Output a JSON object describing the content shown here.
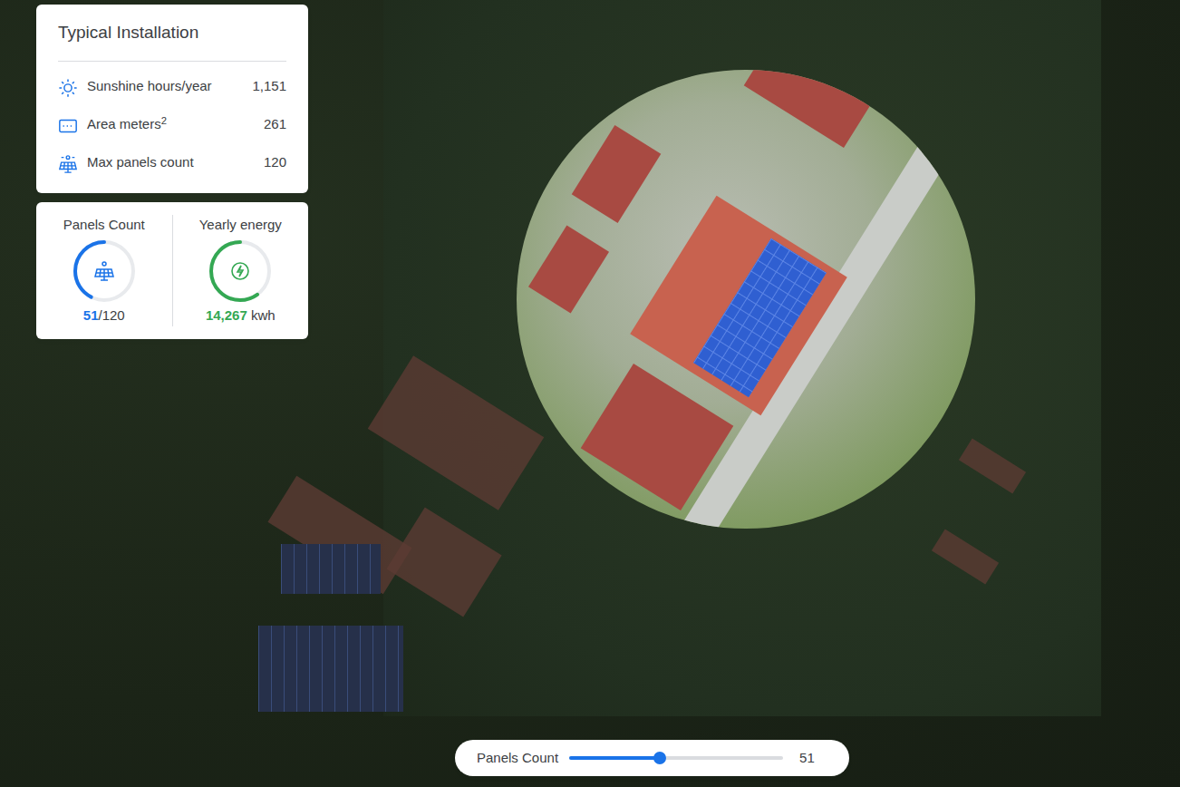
{
  "summary": {
    "title": "Typical Installation",
    "rows": [
      {
        "label": "Sunshine hours/year",
        "value": "1,151"
      },
      {
        "label": "Area meters",
        "sup": "2",
        "value": "261"
      },
      {
        "label": "Max panels count",
        "value": "120"
      }
    ]
  },
  "gauges": [
    {
      "label": "Panels Count",
      "value": "51",
      "suffix": "/120",
      "level": 0.425,
      "color": "#1a73e8"
    },
    {
      "label": "Yearly energy",
      "value": "14,267",
      "suffix": "kwh",
      "level": 0.6,
      "color": "#34a853"
    }
  ],
  "slider": {
    "label": "Panels Count",
    "value": "51",
    "level": 0.425
  }
}
